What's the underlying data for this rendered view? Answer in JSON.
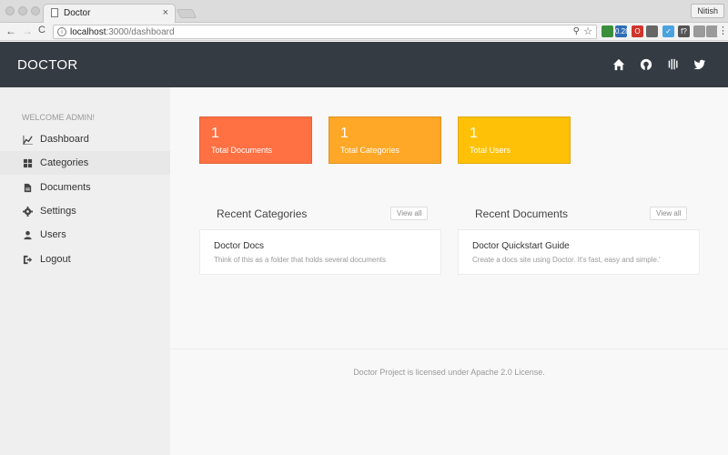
{
  "browser": {
    "tab_title": "Doctor",
    "tab_close": "×",
    "user_name": "Nitish",
    "url_host": "localhost",
    "url_rest": ":3000/dashboard",
    "back": "←",
    "forward": "→",
    "reload": "C",
    "extensions": [
      {
        "name": "green-extension-icon",
        "text": "",
        "color": "#3b8f3b"
      },
      {
        "name": "badge-extension-icon",
        "text": "0.28",
        "color": "#2f6db5"
      },
      {
        "name": "opera-extension-icon",
        "text": "O",
        "color": "#d0342c"
      },
      {
        "name": "block-extension-icon",
        "text": "",
        "color": "#666666"
      },
      {
        "name": "feather-extension-icon",
        "text": "✓",
        "color": "#4aa3df"
      },
      {
        "name": "formula-extension-icon",
        "text": "f?",
        "color": "#555555"
      },
      {
        "name": "puzzle-extension-icon",
        "text": "",
        "color": "#9a9a9a"
      },
      {
        "name": "copy-extension-icon",
        "text": "",
        "color": "#9a9a9a"
      },
      {
        "name": "menu-icon",
        "text": "⋮",
        "color": "#f2f2f2"
      }
    ]
  },
  "header": {
    "brand": "DOCTOR",
    "icons": [
      "home-icon",
      "github-icon",
      "intercom-icon",
      "twitter-icon"
    ]
  },
  "sidebar": {
    "welcome": "WELCOME ADMIN!",
    "items": [
      {
        "label": "Dashboard",
        "icon": "chart-line-icon",
        "active": false
      },
      {
        "label": "Categories",
        "icon": "grid-icon",
        "active": true
      },
      {
        "label": "Documents",
        "icon": "document-icon",
        "active": false
      },
      {
        "label": "Settings",
        "icon": "gear-icon",
        "active": false
      },
      {
        "label": "Users",
        "icon": "user-icon",
        "active": false
      },
      {
        "label": "Logout",
        "icon": "logout-icon",
        "active": false
      }
    ]
  },
  "stats": [
    {
      "value": "1",
      "label": "Total Documents",
      "color": "#ff7043"
    },
    {
      "value": "1",
      "label": "Total Categories",
      "color": "#ffa726"
    },
    {
      "value": "1",
      "label": "Total Users",
      "color": "#ffc107"
    }
  ],
  "recent_categories": {
    "title": "Recent Categories",
    "view_all": "View all",
    "item_title": "Doctor Docs",
    "item_desc": "Think of this as a folder that holds several documents"
  },
  "recent_documents": {
    "title": "Recent Documents",
    "view_all": "View all",
    "item_title": "Doctor Quickstart Guide",
    "item_desc": "Create a docs site using Doctor. It's fast, easy and simple.'"
  },
  "footer": "Doctor Project is licensed under Apache 2.0 License."
}
